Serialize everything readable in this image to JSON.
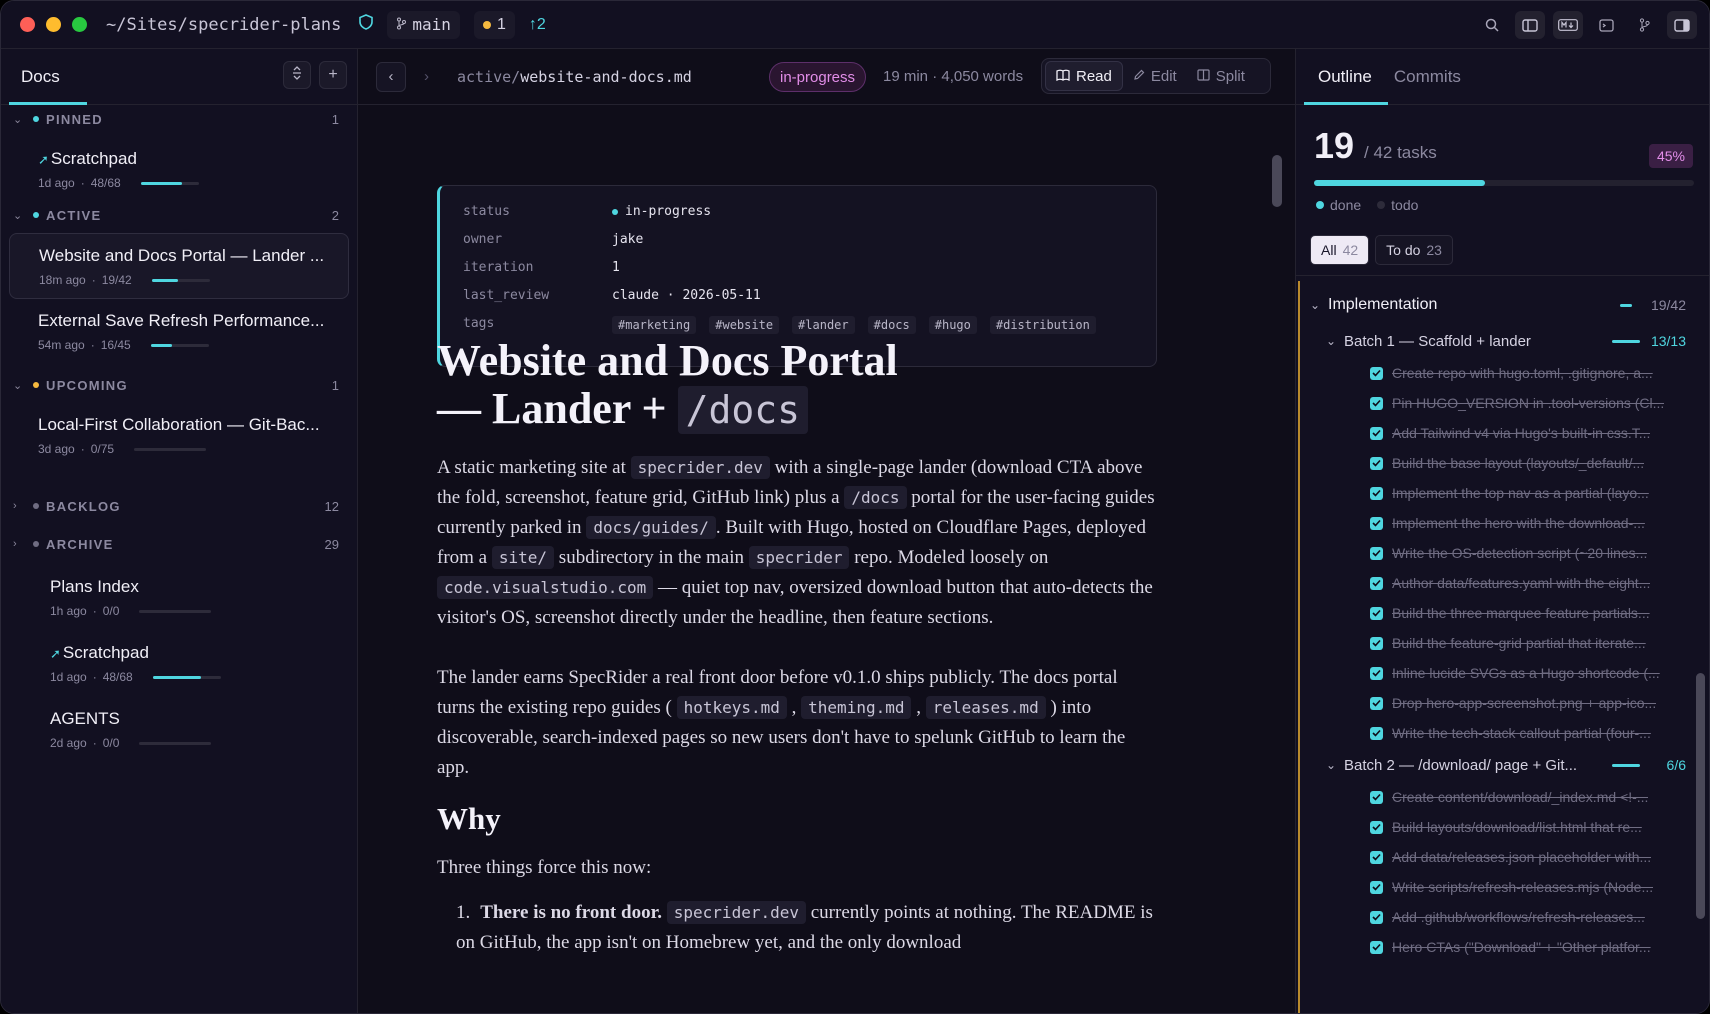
{
  "titlebar": {
    "path": "~/Sites/specrider-plans",
    "branch": "main",
    "changes": "1",
    "ahead": "↑2"
  },
  "sidebar": {
    "title": "Docs",
    "groups": {
      "pinned": {
        "label": "PINNED",
        "count": "1"
      },
      "active": {
        "label": "ACTIVE",
        "count": "2"
      },
      "upcoming": {
        "label": "UPCOMING",
        "count": "1"
      },
      "backlog": {
        "label": "BACKLOG",
        "count": "12"
      },
      "archive": {
        "label": "ARCHIVE",
        "count": "29"
      }
    },
    "docs": [
      {
        "title": "Scratchpad",
        "age": "1d ago",
        "progress": "48/68",
        "fraction": 0.71
      },
      {
        "title": "Website and Docs Portal — Lander ...",
        "age": "18m ago",
        "progress": "19/42",
        "fraction": 0.45
      },
      {
        "title": "External Save Refresh Performance...",
        "age": "54m ago",
        "progress": "16/45",
        "fraction": 0.36
      },
      {
        "title": "Local-First Collaboration — Git-Bac...",
        "age": "3d ago",
        "progress": "0/75",
        "fraction": 0
      },
      {
        "title": "Plans Index",
        "age": "1h ago",
        "progress": "0/0",
        "fraction": 0
      },
      {
        "title": "Scratchpad",
        "age": "1d ago",
        "progress": "48/68",
        "fraction": 0.71
      },
      {
        "title": "AGENTS",
        "age": "2d ago",
        "progress": "0/0",
        "fraction": 0
      }
    ]
  },
  "main": {
    "path_dir": "active/",
    "path_file": "website-and-docs.md",
    "status": "in-progress",
    "readtime": "19 min · 4,050 words",
    "modes": {
      "read": "Read",
      "edit": "Edit",
      "split": "Split"
    },
    "frontmatter": {
      "status_key": "status",
      "status_val": "in-progress",
      "owner_key": "owner",
      "owner_val": "jake",
      "iteration_key": "iteration",
      "iteration_val": "1",
      "review_key": "last_review",
      "review_val": "claude · 2026-05-11",
      "tags_key": "tags",
      "tags": [
        "#marketing",
        "#website",
        "#lander",
        "#docs",
        "#hugo",
        "#distribution"
      ]
    },
    "h1_line1": "Website and Docs Portal",
    "h1_line2": "— Lander + ",
    "h1_code": "/docs",
    "p1": {
      "t1": "A static marketing site at ",
      "c1": "specrider.dev",
      "t2": " with a single-page lander (download CTA above the fold, screenshot, feature grid, GitHub link) plus a ",
      "c2": "/docs",
      "t3": " portal for the user-facing guides currently parked in ",
      "c3": "docs/guides/",
      "t4": ". Built with Hugo, hosted on Cloudflare Pages, deployed from a ",
      "c4": "site/",
      "t5": " subdirectory in the main ",
      "c5": "specrider",
      "t6": " repo. Modeled loosely on ",
      "c6": "code.visualstudio.com",
      "t7": " — quiet top nav, oversized download button that auto-detects the visitor's OS, screenshot directly under the headline, then feature sections."
    },
    "p2": {
      "t1": "The lander earns SpecRider a real front door before v0.1.0 ships publicly. The docs portal turns the existing repo guides ( ",
      "c1": "hotkeys.md",
      "t2": " , ",
      "c2": "theming.md",
      "t3": " , ",
      "c3": "releases.md",
      "t4": " ) into discoverable, search-indexed pages so new users don't have to spelunk GitHub to learn the app."
    },
    "h2": "Why",
    "p3": "Three things force this now:",
    "li1": {
      "num": "1.",
      "bold": "There is no front door.",
      "code": "specrider.dev",
      "t1": " currently points at nothing. The README is on GitHub, the app isn't on Homebrew yet, and the only download"
    }
  },
  "right": {
    "tabs": {
      "outline": "Outline",
      "commits": "Commits"
    },
    "done_count": "19",
    "total": "/ 42 tasks",
    "percent": "45%",
    "progress_fraction": 0.45,
    "legend_done": "done",
    "legend_todo": "todo",
    "filter_all": "All",
    "filter_all_count": "42",
    "filter_todo": "To do",
    "filter_todo_count": "23",
    "section": {
      "label": "Implementation",
      "count": "19/42"
    },
    "batch1": {
      "label": "Batch 1 — Scaffold + lander",
      "count": "13/13"
    },
    "batch1_tasks": [
      "Create repo with hugo.toml, .gitignore, a...",
      "Pin HUGO_VERSION in .tool-versions (Cl...",
      "Add Tailwind v4 via Hugo's built-in css.T...",
      "Build the base layout (layouts/_default/...",
      "Implement the top nav as a partial (layo...",
      "Implement the hero with the download-...",
      "Write the OS-detection script (~20 lines...",
      "Author data/features.yaml with the eight...",
      "Build the three marquee feature partials...",
      "Build the feature-grid partial that iterate...",
      "Inline lucide SVGs as a Hugo shortcode (...",
      "Drop hero-app-screenshot.png + app-ico...",
      "Write the tech-stack callout partial (four-..."
    ],
    "batch2": {
      "label": "Batch 2 — /download/ page + Git...",
      "count": "6/6"
    },
    "batch2_tasks": [
      "Create content/download/_index.md <!-...",
      "Build layouts/download/list.html that re...",
      "Add data/releases.json placeholder with...",
      "Write scripts/refresh-releases.mjs (Node...",
      "Add .github/workflows/refresh-releases...",
      "Hero CTAs (\"Download\" + \"Other platfor..."
    ]
  },
  "colors": {
    "accent": "#4fd6e0",
    "status": "#e28de8",
    "warn": "#f5b93f"
  }
}
